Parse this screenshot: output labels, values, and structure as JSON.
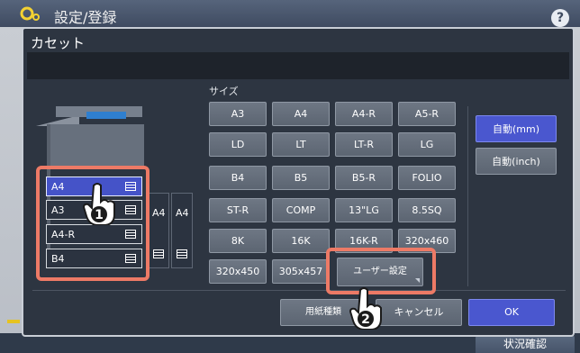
{
  "app": {
    "title": "設定/登録",
    "help_label": "?"
  },
  "dialog": {
    "title": "カセット",
    "message": ""
  },
  "drawers": [
    {
      "label": "A4",
      "selected": true
    },
    {
      "label": "A3",
      "selected": false
    },
    {
      "label": "A4-R",
      "selected": false
    },
    {
      "label": "B4",
      "selected": false
    }
  ],
  "side_drawers": [
    {
      "label": "A4"
    },
    {
      "label": "A4"
    }
  ],
  "size_section": {
    "label": "サイズ",
    "rows": [
      [
        "A3",
        "A4",
        "A4-R",
        "A5-R"
      ],
      [
        "LD",
        "LT",
        "LT-R",
        "LG"
      ],
      [
        "B4",
        "B5",
        "B5-R",
        "FOLIO"
      ],
      [
        "ST-R",
        "COMP",
        "13\"LG",
        "8.5SQ"
      ],
      [
        "8K",
        "16K",
        "16K-R",
        "320x460"
      ],
      [
        "320x450",
        "305x457"
      ]
    ],
    "user_setting": "ユーザー設定"
  },
  "units": [
    {
      "label": "自動(mm)",
      "active": true
    },
    {
      "label": "自動(inch)",
      "active": false
    }
  ],
  "footer": {
    "paper_type": "用紙種類",
    "cancel": "キャンセル",
    "ok": "OK"
  },
  "status_bar": {
    "check_label": "状況確認"
  },
  "callouts": [
    "1",
    "2"
  ],
  "colors": {
    "accent": "#4a57cf",
    "highlight": "#ed7a66",
    "dialog_bg": "#2d3541"
  }
}
